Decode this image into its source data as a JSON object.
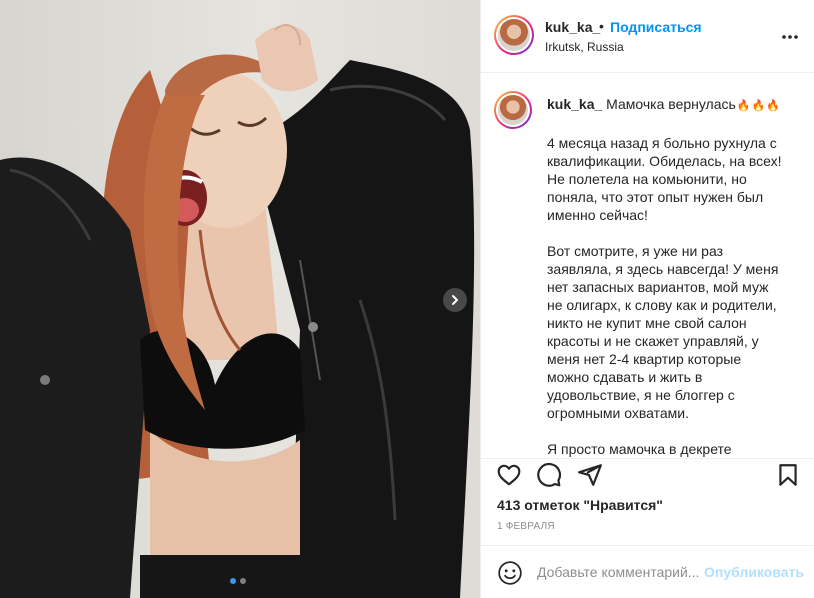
{
  "post": {
    "username": "kuk_ka_",
    "separator": "•",
    "follow_label": "Подписаться",
    "location": "Irkutsk, Russia"
  },
  "caption": {
    "username": "kuk_ka_",
    "title": "Мамочка вернулась",
    "flames": "🔥🔥🔥",
    "body": "4 месяца назад я больно рухнула с квалификации. Обиделась, на всех! Не полетела на комьюнити, но поняла, что этот опыт нужен был именно сейчас!\n\nВот смотрите, я уже ни раз заявляла, я здесь навсегда! У меня нет запасных вариантов, мой муж не олигарх, к слову как и родители, никто не купит мне свой салон красоты и не скажет управляй, у меня нет 2-4 квартир которые можно сдавать и жить в удовольствие, я не блоггер с огромными охватами.\n\nЯ просто мамочка в декрете"
  },
  "stats": {
    "likes": "413 отметок \"Нравится\"",
    "date": "1 ФЕВРАЛЯ"
  },
  "comment": {
    "placeholder": "Добавьте комментарий...",
    "publish_label": "Опубликовать"
  },
  "carousel": {
    "current_slide": 1,
    "total_slides": 2
  },
  "icons": {
    "more": "more-dots-icon",
    "like": "heart-icon",
    "comment": "comment-icon",
    "share": "paper-plane-icon",
    "save": "bookmark-icon",
    "emoji": "smiley-icon",
    "next": "chevron-right-icon"
  },
  "colors": {
    "accent": "#0095f6",
    "publish_disabled": "#b2dffc",
    "muted": "#8e8e8e",
    "border": "#efefef"
  }
}
